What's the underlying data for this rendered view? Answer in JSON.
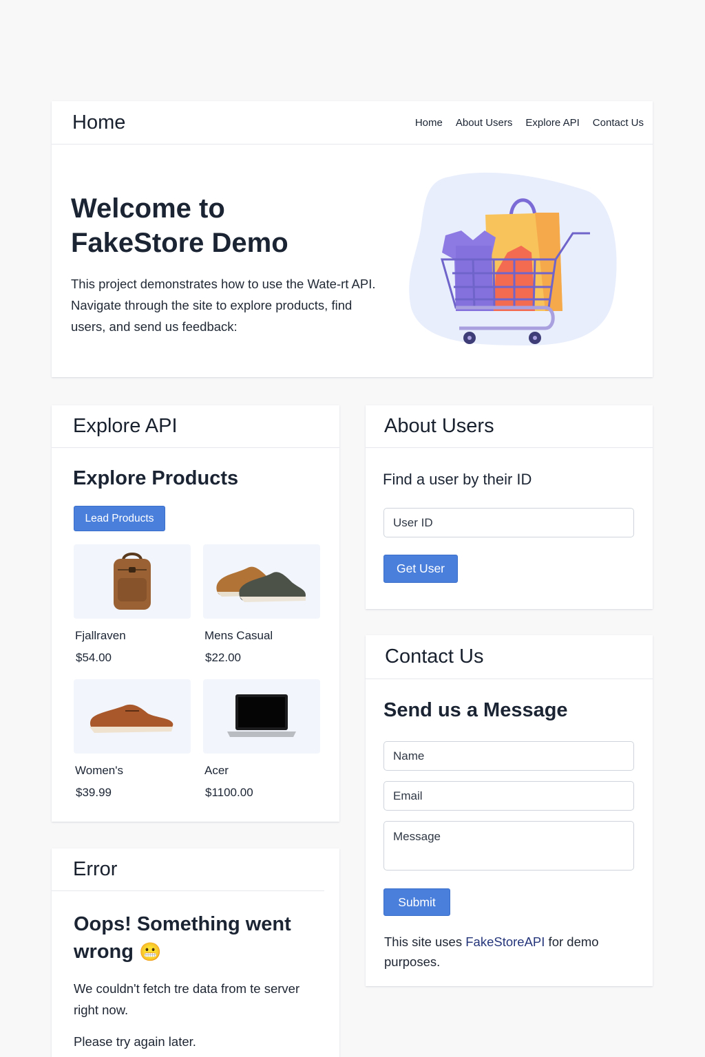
{
  "nav": {
    "brand": "Home",
    "links": [
      "Home",
      "About Users",
      "Explore API",
      "Contact Us"
    ]
  },
  "hero": {
    "title": "Welcome to FakeStore Demo",
    "text": "This project demonstrates how to use the Wate-rt API. Navigate through the site to explore products, find users, and send us feedback:",
    "illustration": "shopping-cart-illustration"
  },
  "explore": {
    "header": "Explore API",
    "title": "Explore Products",
    "load_button": "Lead Products",
    "products": [
      {
        "name": "Fjallraven",
        "price": "$54.00",
        "icon": "backpack-icon"
      },
      {
        "name": "Mens Casual",
        "price": "$22.00",
        "icon": "mens-shoes-icon"
      },
      {
        "name": "Women's",
        "price": "$39.99",
        "icon": "womens-shoe-icon"
      },
      {
        "name": "Acer",
        "price": "$1100.00",
        "icon": "laptop-icon"
      }
    ]
  },
  "error": {
    "header": "Error",
    "title": "Oops! Something went wrong",
    "emoji": "😬",
    "message": "We couldn't fetch tre data from te server right now.",
    "retry": "Please try again later."
  },
  "users": {
    "header": "About Users",
    "subtitle": "Find a user by their ID",
    "input_placeholder": "User ID",
    "button": "Get User"
  },
  "contact": {
    "header": "Contact Us",
    "title": "Send us a Message",
    "name_placeholder": "Name",
    "email_placeholder": "Email",
    "message_placeholder": "Message",
    "submit": "Submit",
    "footer_prefix": "This site uses ",
    "footer_link": "FakeStoreAPI",
    "footer_suffix": " for demo purposes."
  },
  "colors": {
    "primary": "#4a7fdc",
    "background": "#f8f8f9",
    "text": "#1b2433",
    "link": "#25357a"
  }
}
